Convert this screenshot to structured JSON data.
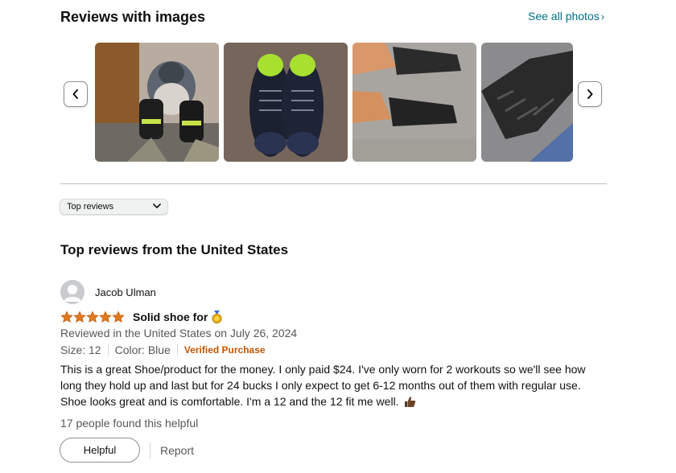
{
  "images_section": {
    "title": "Reviews with images",
    "see_all_label": "See all photos",
    "prev_icon": "chevron-left-icon",
    "next_icon": "chevron-right-icon",
    "thumbnails": [
      {
        "alt": "dog-and-shoes-photo"
      },
      {
        "alt": "black-shoes-pair-photo"
      },
      {
        "alt": "shoes-on-feet-photo"
      },
      {
        "alt": "shoe-sole-photo"
      }
    ]
  },
  "sort": {
    "selected": "Top reviews",
    "icon": "chevron-down-icon"
  },
  "reviews_section": {
    "title": "Top reviews from the United States"
  },
  "review": {
    "author": "Jacob Ulman",
    "rating": 5,
    "star_color": "#de7921",
    "title": "Solid shoe for",
    "title_emoji": "medal",
    "meta": "Reviewed in the United States on July 26, 2024",
    "size": "Size: 12",
    "color": "Color: Blue",
    "verified": "Verified Purchase",
    "verified_color": "#c45500",
    "body": "This is a great Shoe/product for the money. I only paid $24. I've only worn for 2 workouts so we'll see how long they hold up and last but for 24 bucks I only expect to get 6-12 months out of them with regular use. Shoe looks great and is comfortable. I'm a 12 and the 12 fit me well.",
    "body_emoji": "thumbs-up",
    "helpful_count_text": "17 people found this helpful",
    "helpful_button": "Helpful",
    "report_link": "Report"
  }
}
